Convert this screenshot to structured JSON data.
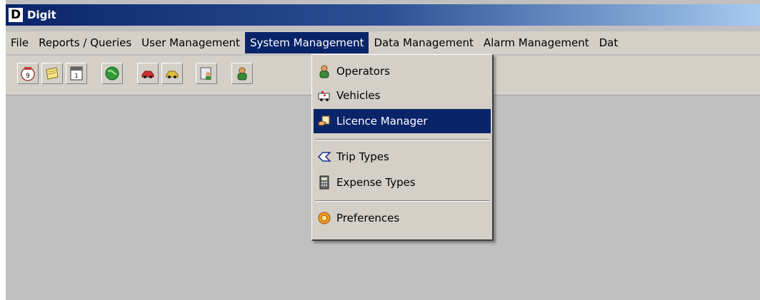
{
  "window": {
    "title": "Digit",
    "logo_letter": "D"
  },
  "menubar": {
    "items": [
      {
        "label": "File"
      },
      {
        "label": "Reports / Queries"
      },
      {
        "label": "User Management"
      },
      {
        "label": "System Management",
        "active": true
      },
      {
        "label": "Data Management"
      },
      {
        "label": "Alarm Management"
      },
      {
        "label": "Dat"
      }
    ]
  },
  "toolbar": {
    "buttons": [
      {
        "icon": "calendar-day-icon"
      },
      {
        "icon": "notepad-icon"
      },
      {
        "icon": "calendar-month-icon"
      },
      {
        "icon": "globe-icon"
      },
      {
        "icon": "car-red-icon"
      },
      {
        "icon": "car-yellow-icon"
      },
      {
        "icon": "document-person-icon"
      },
      {
        "icon": "operator-icon"
      }
    ]
  },
  "system_menu": {
    "items": [
      {
        "label": "Operators",
        "icon": "operator-icon"
      },
      {
        "label": "Vehicles",
        "icon": "ambulance-icon"
      },
      {
        "label": "Licence Manager",
        "icon": "licence-hand-icon",
        "highlighted": true
      },
      {
        "label": "Trip Types",
        "icon": "tag-icon"
      },
      {
        "label": "Expense Types",
        "icon": "calculator-icon"
      },
      {
        "label": "Preferences",
        "icon": "gear-icon"
      }
    ]
  },
  "colors": {
    "highlight": "#0a246a",
    "face": "#d4d0c8",
    "workspace": "#c0c0c0"
  }
}
